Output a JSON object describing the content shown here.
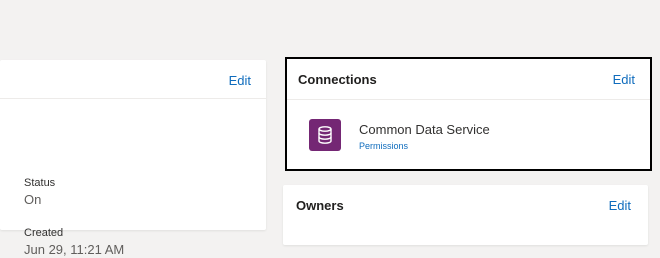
{
  "details": {
    "edit_label": "Edit",
    "status_label": "Status",
    "status_value": "On",
    "created_label": "Created",
    "created_value": "Jun 29, 11:21 AM"
  },
  "connections": {
    "title": "Connections",
    "edit_label": "Edit",
    "items": [
      {
        "name": "Common Data Service",
        "permissions_label": "Permissions",
        "icon": "database-icon",
        "icon_color": "#742774"
      }
    ]
  },
  "owners": {
    "title": "Owners",
    "edit_label": "Edit"
  },
  "colors": {
    "link": "#0f6cbd",
    "background": "#f3f2f1",
    "highlight_border": "#000000"
  }
}
